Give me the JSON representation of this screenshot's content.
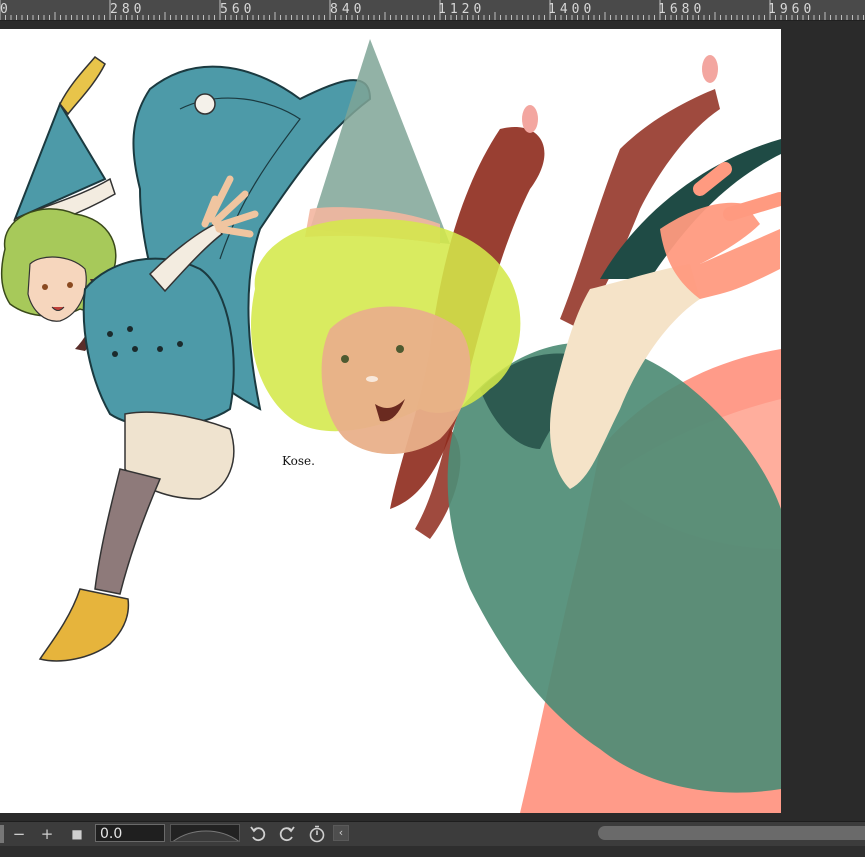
{
  "ruler": {
    "labels": [
      "0",
      "280",
      "560",
      "840",
      "1120",
      "1400",
      "1680",
      "1960"
    ]
  },
  "colors": {
    "ruler_bg": "#4a4a4a",
    "workspace_bg": "#2a2a2a",
    "canvas_bg": "#ffffff",
    "toolbar_bg": "#3c3c3c"
  },
  "bottombar": {
    "minus_label": "−",
    "plus_label": "+",
    "stop_label": "■",
    "value_field": "0.0",
    "undo_icon": "undo-icon",
    "redo_icon": "redo-icon",
    "timer_icon": "stopwatch-icon",
    "collapse_label": "‹"
  },
  "canvas": {
    "signature_text": "Kose."
  }
}
